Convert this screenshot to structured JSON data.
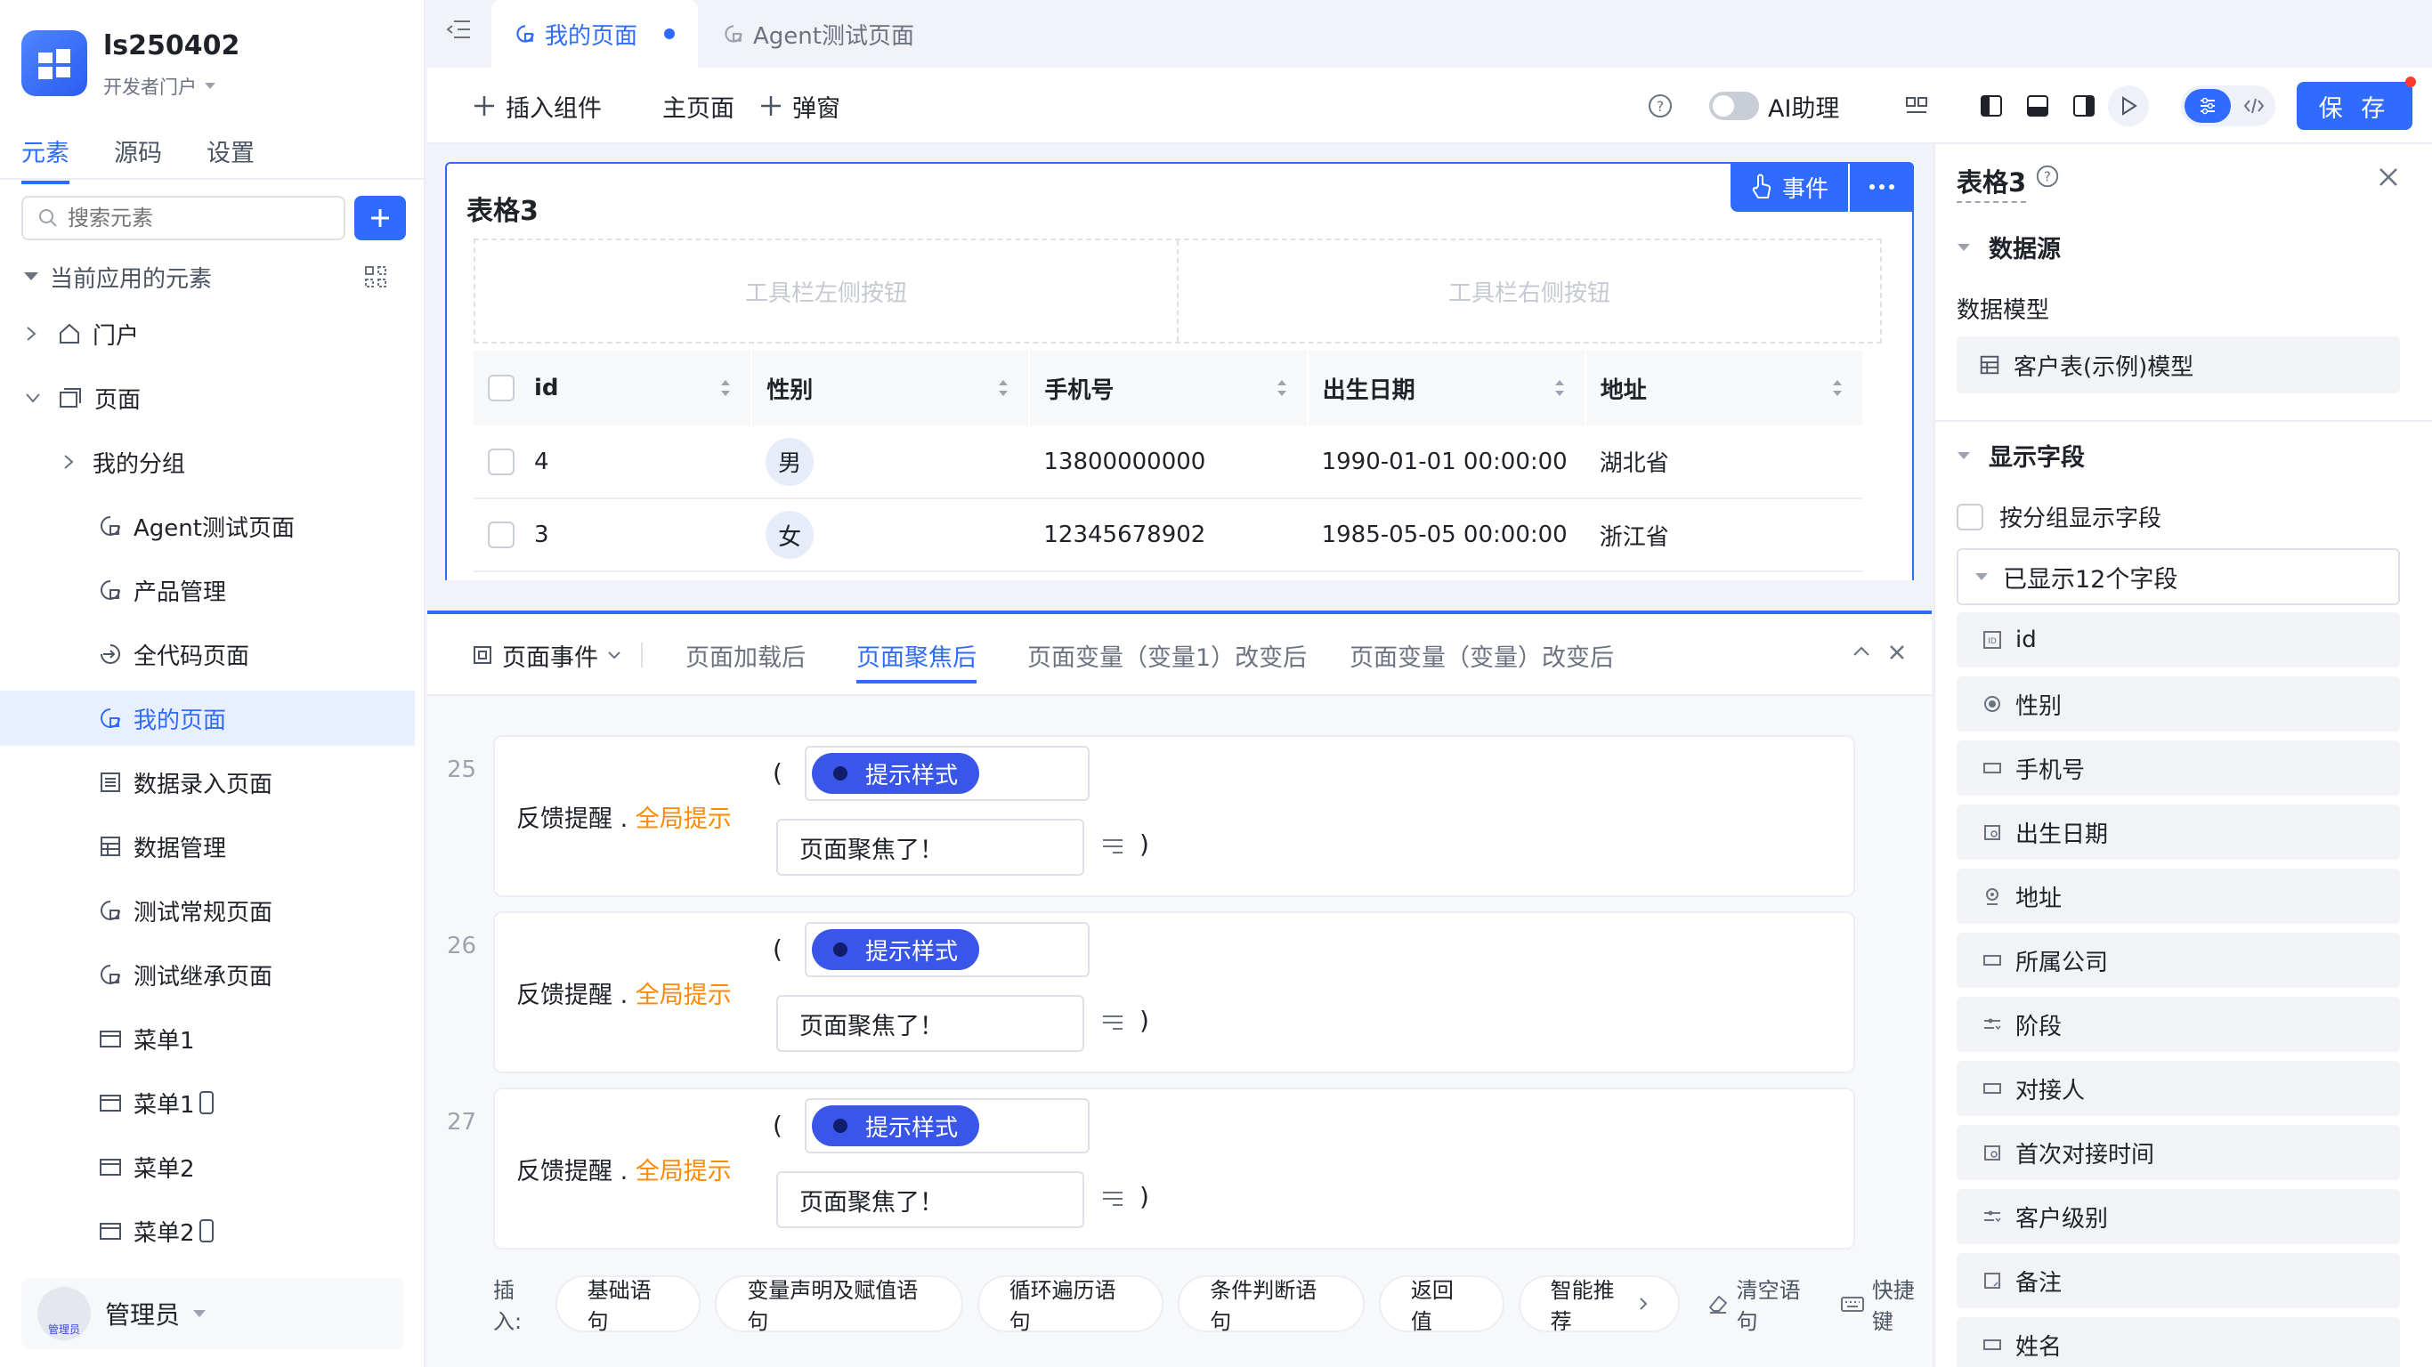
{
  "app": {
    "name": "ls250402",
    "portal": "开发者门户"
  },
  "sidebar": {
    "tabs": [
      {
        "label": "元素"
      },
      {
        "label": "源码"
      },
      {
        "label": "设置"
      }
    ],
    "search_placeholder": "搜索元素",
    "section_title": "当前应用的元素",
    "tree": [
      {
        "label": "门户"
      },
      {
        "label": "页面"
      },
      {
        "label": "我的分组"
      },
      {
        "label": "Agent测试页面"
      },
      {
        "label": "产品管理"
      },
      {
        "label": "全代码页面"
      },
      {
        "label": "我的页面"
      },
      {
        "label": "数据录入页面"
      },
      {
        "label": "数据管理"
      },
      {
        "label": "测试常规页面"
      },
      {
        "label": "测试继承页面"
      },
      {
        "label": "菜单1"
      },
      {
        "label": "菜单1"
      },
      {
        "label": "菜单2"
      },
      {
        "label": "菜单2"
      }
    ],
    "user": {
      "name": "管理员",
      "avatar_text": "管理员"
    }
  },
  "tabs": [
    {
      "label": "我的页面"
    },
    {
      "label": "Agent测试页面"
    }
  ],
  "toolbar": {
    "insert_component": "插入组件",
    "main_page": "主页面",
    "popup": "弹窗",
    "ai_assistant": "AI助理",
    "save": "保 存"
  },
  "table_component": {
    "title": "表格3",
    "event_btn": "事件",
    "toolbar_left": "工具栏左侧按钮",
    "toolbar_right": "工具栏右侧按钮",
    "columns": [
      "id",
      "性别",
      "手机号",
      "出生日期",
      "地址"
    ],
    "rows": [
      {
        "id": "4",
        "gender": "男",
        "phone": "13800000000",
        "birth": "1990-01-01 00:00:00",
        "address": "湖北省"
      },
      {
        "id": "3",
        "gender": "女",
        "phone": "12345678902",
        "birth": "1985-05-05 00:00:00",
        "address": "浙江省"
      }
    ]
  },
  "events_panel": {
    "tabs": [
      {
        "label": "页面事件"
      },
      {
        "label": "页面加载后"
      },
      {
        "label": "页面聚焦后"
      },
      {
        "label": "页面变量（变量1）改变后"
      },
      {
        "label": "页面变量（变量）改变后"
      }
    ],
    "statements": [
      {
        "num": "25",
        "action": "反馈提醒",
        "dot": ".",
        "target": "全局提示",
        "style": "提示样式",
        "message": "页面聚焦了！"
      },
      {
        "num": "26",
        "action": "反馈提醒",
        "dot": ".",
        "target": "全局提示",
        "style": "提示样式",
        "message": "页面聚焦了！"
      },
      {
        "num": "27",
        "action": "反馈提醒",
        "dot": ".",
        "target": "全局提示",
        "style": "提示样式",
        "message": "页面聚焦了！"
      }
    ],
    "insert_label": "插入:",
    "insert_buttons": [
      {
        "label": "基础语句"
      },
      {
        "label": "变量声明及赋值语句"
      },
      {
        "label": "循环遍历语句"
      },
      {
        "label": "条件判断语句"
      },
      {
        "label": "返回值"
      },
      {
        "label": "智能推荐"
      }
    ],
    "clear": "清空语句",
    "shortcut": "快捷键"
  },
  "props_panel": {
    "title": "表格3",
    "datasource_title": "数据源",
    "model_label": "数据模型",
    "model_value": "客户表(示例)模型",
    "display_fields_title": "显示字段",
    "group_display": "按分组显示字段",
    "shown_fields": "已显示12个字段",
    "fields": [
      {
        "label": "id"
      },
      {
        "label": "性别"
      },
      {
        "label": "手机号"
      },
      {
        "label": "出生日期"
      },
      {
        "label": "地址"
      },
      {
        "label": "所属公司"
      },
      {
        "label": "阶段"
      },
      {
        "label": "对接人"
      },
      {
        "label": "首次对接时间"
      },
      {
        "label": "客户级别"
      },
      {
        "label": "备注"
      },
      {
        "label": "姓名"
      }
    ]
  },
  "colors": {
    "accent": "#2f6bff",
    "orange": "#ff8a00",
    "chip": "#3a56e8"
  }
}
